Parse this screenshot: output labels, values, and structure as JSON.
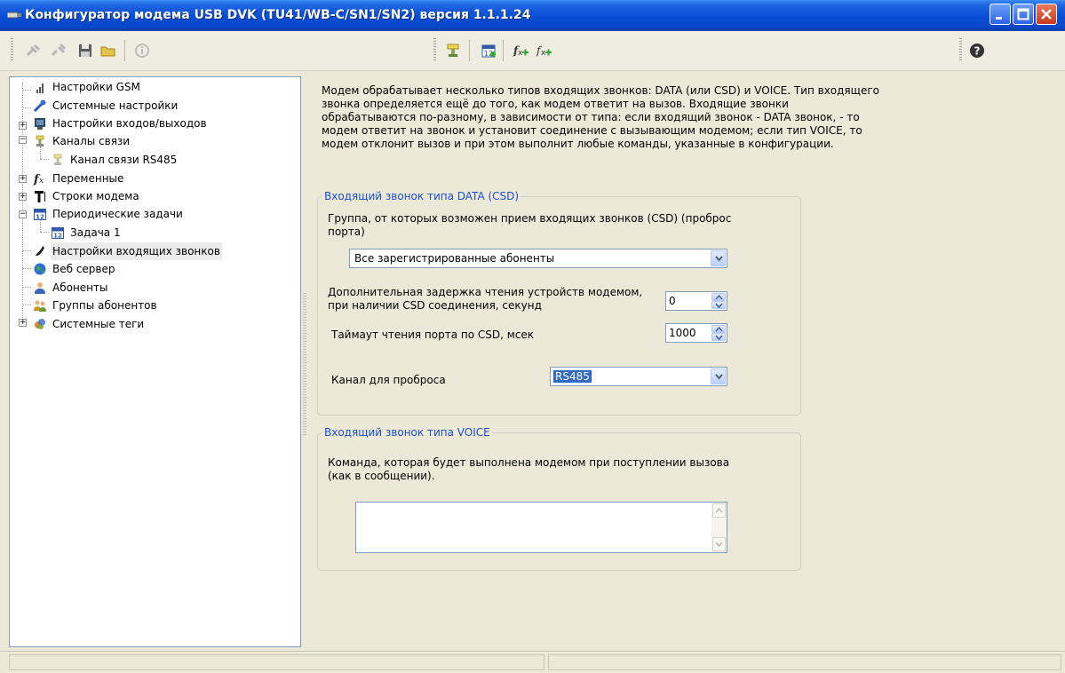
{
  "window": {
    "title": "Конфигуратор модема USB DVK (TU41/WB-C/SN1/SN2)  версия 1.1.1.24"
  },
  "toolbar": {
    "left_icons": [
      "connect-icon",
      "disconnect-icon",
      "save-icon",
      "open-folder-icon",
      "info-icon"
    ],
    "middle_icons": [
      "add-channel-icon",
      "add-task-icon",
      "add-variable-icon",
      "add-function-icon"
    ],
    "right_icons": [
      "help-icon"
    ]
  },
  "tree": {
    "items": [
      {
        "label": "Настройки GSM",
        "icon": "signal-icon",
        "level": 0
      },
      {
        "label": "Системные настройки",
        "icon": "wrench-icon",
        "level": 0
      },
      {
        "label": "Настройки входов/выходов",
        "icon": "io-board-icon",
        "level": 0,
        "expander": "+"
      },
      {
        "label": "Каналы связи",
        "icon": "channel-icon",
        "level": 0,
        "expander": "−"
      },
      {
        "label": "Канал связи RS485",
        "icon": "channel-icon",
        "level": 1
      },
      {
        "label": "Переменные",
        "icon": "function-icon",
        "level": 0,
        "expander": "+"
      },
      {
        "label": "Строки модема",
        "icon": "text-icon",
        "level": 0,
        "expander": "+"
      },
      {
        "label": "Периодические задачи",
        "icon": "calendar-icon",
        "level": 0,
        "expander": "−"
      },
      {
        "label": "Задача 1",
        "icon": "calendar-icon",
        "level": 1
      },
      {
        "label": "Настройки входящих звонков",
        "icon": "phone-icon",
        "level": 0,
        "selected": true
      },
      {
        "label": "Веб сервер",
        "icon": "globe-icon",
        "level": 0
      },
      {
        "label": "Абоненты",
        "icon": "user-icon",
        "level": 0
      },
      {
        "label": "Группы абонентов",
        "icon": "users-icon",
        "level": 0
      },
      {
        "label": "Системные теги",
        "icon": "tags-icon",
        "level": 0,
        "expander": "+"
      }
    ]
  },
  "main": {
    "description": "Модем обрабатывает несколько типов входящих звонков: DATA (или CSD) и VOICE. Тип входящего звонка определяется ещё до того, как модем ответит на вызов. Входящие звонки обрабатываются по-разному, в зависимости от типа: если входящий звонок - DATA звонок, - то модем ответит на звонок и установит соединение с вызывающим модемом; если тип VOICE, то модем отклонит вызов и при этом выполнит любые команды, указанные в конфигурации.",
    "data_group": {
      "title": "Входящий звонок типа DATA (CSD)",
      "group_label": "Группа, от которых возможен прием входящих звонков (CSD) (проброс порта)",
      "group_value": "Все зарегистрированные абоненты",
      "delay_label": "Дополнительная задержка чтения устройств модемом, при наличии CSD соединения, секунд",
      "delay_value": "0",
      "timeout_label": "Таймаут чтения порта по CSD, мсек",
      "timeout_value": "1000",
      "channel_label": "Канал для проброса",
      "channel_value": "RS485"
    },
    "voice_group": {
      "title": "Входящий звонок типа VOICE",
      "command_label": "Команда, которая будет выполнена модемом при поступлении вызова (как в сообщении).",
      "command_value": ""
    }
  }
}
